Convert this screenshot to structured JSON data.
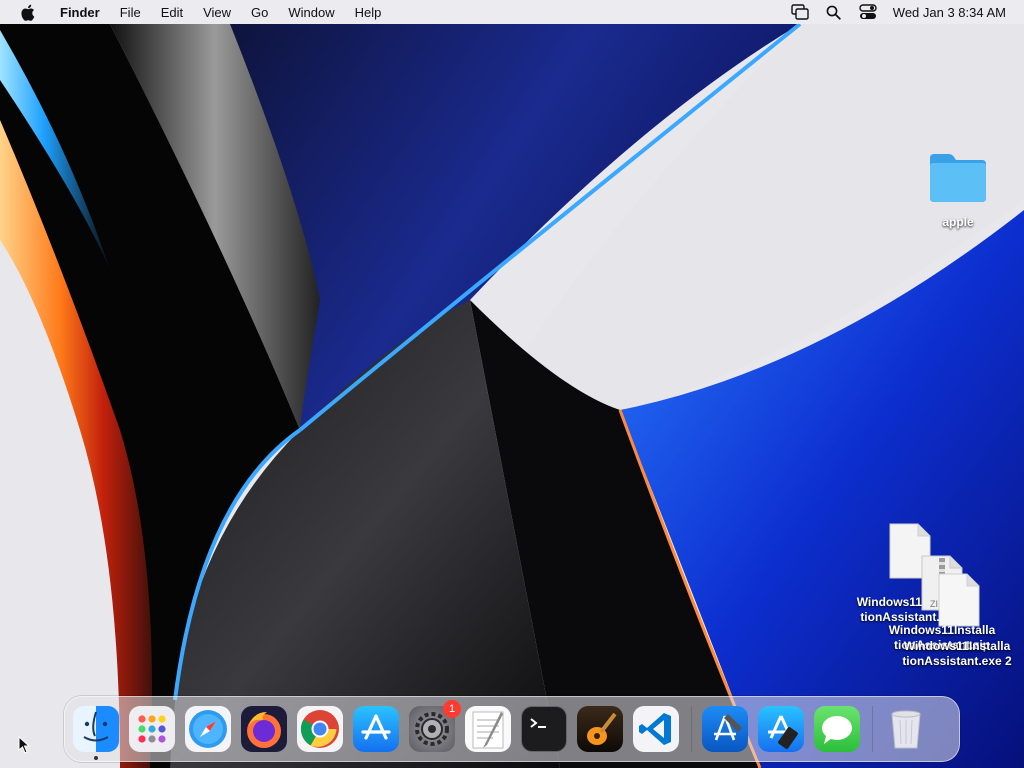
{
  "menubar": {
    "apple_icon": "apple-logo-icon",
    "app_name": "Finder",
    "menus": [
      "File",
      "Edit",
      "View",
      "Go",
      "Window",
      "Help"
    ],
    "status_icons": [
      "screen-mirroring-icon",
      "spotlight-search-icon",
      "control-center-icon"
    ],
    "clock": "Wed Jan 3  8:34 AM"
  },
  "desktop": {
    "folder": {
      "label": "apple",
      "icon": "folder-icon"
    },
    "files": [
      {
        "label_line1": "Windows11Installa",
        "label_line2": "tionAssistant.exe",
        "icon": "document-icon"
      },
      {
        "label_line1": "Windows11Installa",
        "label_line2": "tionAssistant.zip",
        "icon": "zip-archive-icon",
        "badge": "ZIP"
      },
      {
        "label_line1": "Windows11Installa",
        "label_line2": "tionAssistant.exe 2",
        "icon": "document-icon"
      }
    ]
  },
  "dock": {
    "apps": [
      {
        "name": "Finder",
        "icon": "finder-icon",
        "running": true
      },
      {
        "name": "Launchpad",
        "icon": "launchpad-icon"
      },
      {
        "name": "Safari",
        "icon": "safari-icon"
      },
      {
        "name": "Firefox",
        "icon": "firefox-icon"
      },
      {
        "name": "Chrome",
        "icon": "chrome-icon"
      },
      {
        "name": "App Store",
        "icon": "app-store-icon"
      },
      {
        "name": "System Settings",
        "icon": "system-settings-icon",
        "badge": "1"
      },
      {
        "name": "TextEdit",
        "icon": "textedit-icon"
      },
      {
        "name": "Terminal",
        "icon": "terminal-icon"
      },
      {
        "name": "GarageBand",
        "icon": "garageband-icon"
      },
      {
        "name": "Visual Studio Code",
        "icon": "vscode-icon"
      }
    ],
    "recent_apps": [
      {
        "name": "Xcode",
        "icon": "xcode-icon"
      },
      {
        "name": "Simulator",
        "icon": "simulator-icon"
      },
      {
        "name": "Messages",
        "icon": "messages-icon"
      }
    ],
    "trash": {
      "name": "Trash",
      "icon": "trash-icon"
    }
  },
  "colors": {
    "accent_blue": "#1e6ff2",
    "folder_blue": "#4ab3f4",
    "badge_red": "#ff3b30",
    "wallpaper_dark": "#0a0a0e",
    "wallpaper_light": "#e8e8ec"
  }
}
